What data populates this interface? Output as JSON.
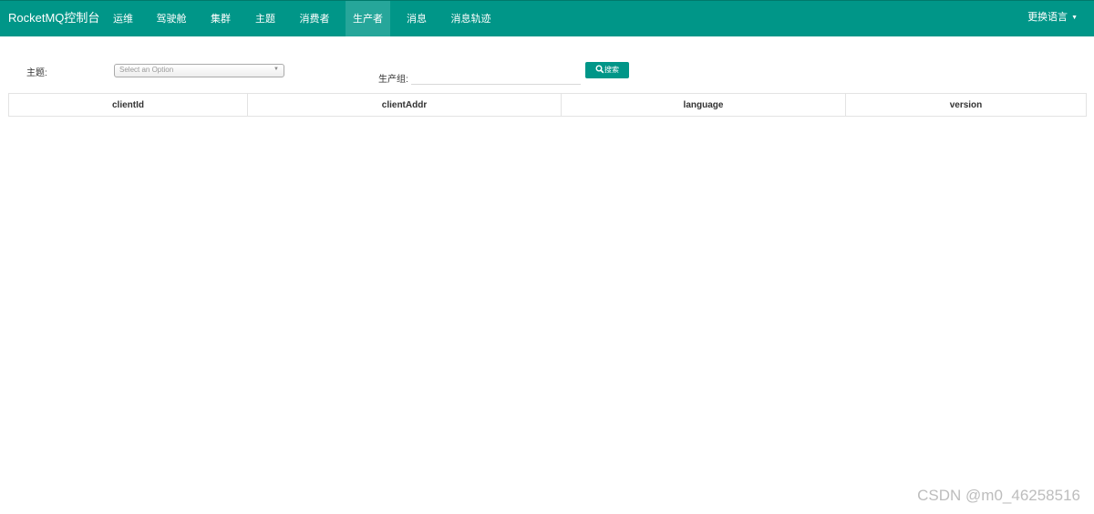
{
  "navbar": {
    "brand": "RocketMQ控制台",
    "items": [
      {
        "label": "运维"
      },
      {
        "label": "驾驶舱"
      },
      {
        "label": "集群"
      },
      {
        "label": "主题"
      },
      {
        "label": "消费者"
      },
      {
        "label": "生产者",
        "active": true
      },
      {
        "label": "消息"
      },
      {
        "label": "消息轨迹"
      }
    ],
    "language": "更换语言"
  },
  "filters": {
    "topic_label": "主题:",
    "topic_placeholder": "Select an Option",
    "group_label": "生产组:",
    "group_value": "",
    "search_label": "搜索"
  },
  "table": {
    "columns": [
      "clientId",
      "clientAddr",
      "language",
      "version"
    ]
  },
  "watermark": "CSDN @m0_46258516",
  "colors": {
    "primary": "#009688",
    "nav_active": "#26a69a"
  }
}
